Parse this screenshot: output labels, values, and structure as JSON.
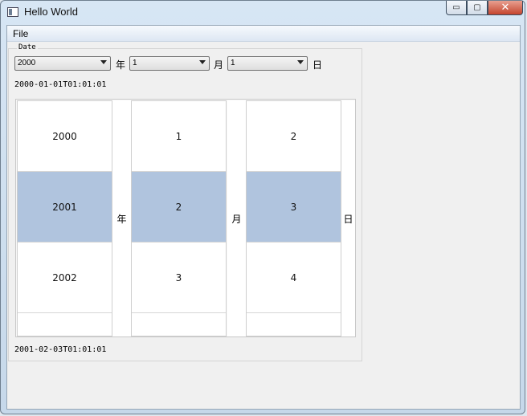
{
  "window": {
    "title": "Hello World",
    "controls": {
      "minimize": "▭",
      "maximize": "▢",
      "close": "✕"
    }
  },
  "menu": {
    "file": "File"
  },
  "group": {
    "title": "Date",
    "year_combo": "2000",
    "month_combo": "1",
    "day_combo": "1",
    "year_unit": "年",
    "month_unit": "月",
    "day_unit": "日",
    "top_datetime": "2000-01-01T01:01:01",
    "bottom_datetime": "2001-02-03T01:01:01"
  },
  "picker": {
    "year": [
      "2000",
      "2001",
      "2002"
    ],
    "month": [
      "1",
      "2",
      "3"
    ],
    "day": [
      "2",
      "3",
      "4"
    ],
    "selected_index": 1,
    "year_label": "年",
    "month_label": "月",
    "day_label": "日"
  }
}
